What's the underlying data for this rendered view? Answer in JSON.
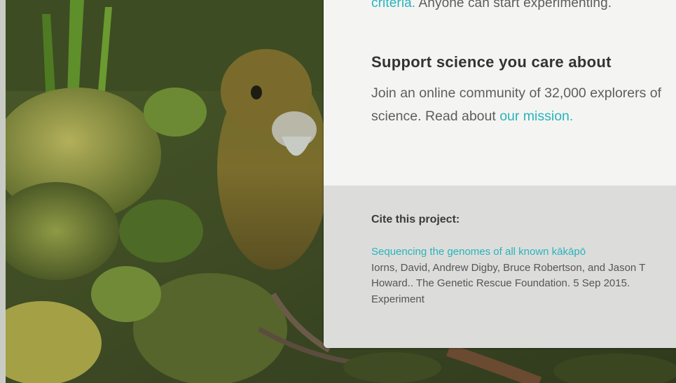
{
  "intro": {
    "criteria_link": "criteria.",
    "criteria_rest": " Anyone can start experimenting."
  },
  "support": {
    "heading": "Support science you care about",
    "text": "Join an online community of 32,000 explorers of science. Read about ",
    "mission_link": "our mission."
  },
  "cite": {
    "heading": "Cite this project:",
    "title_link": "Sequencing the genomes of all known kākāpō",
    "authors": "Iorns, David, Andrew Digby, Bruce Robertson, and Jason T Howard.. The Genetic Rescue Foundation. 5 Sep 2015. Experiment"
  },
  "colors": {
    "accent": "#2ab3bb",
    "panel_light": "#f4f5f3",
    "panel_gray": "#dcdddb"
  }
}
